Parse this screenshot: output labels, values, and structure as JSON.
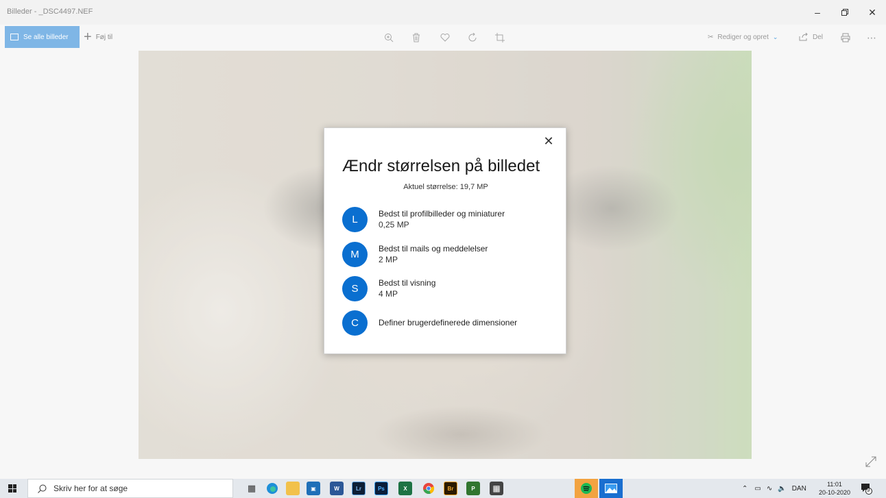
{
  "window": {
    "title": "Billeder - _DSC4497.NEF",
    "minimize_icon": "minimize-icon",
    "maximize_icon": "maximize-icon",
    "close_icon": "close-icon"
  },
  "toolbar": {
    "see_all_label": "Se alle billeder",
    "add_to_label": "Føj til",
    "edit_create_label": "Rediger og opret",
    "share_label": "Del",
    "tools": [
      "zoom-in-icon",
      "delete-icon",
      "favorite-heart-icon",
      "rotate-icon",
      "crop-icon"
    ],
    "accent": "#7fb6e6"
  },
  "dialog": {
    "title": "Ændr størrelsen på billedet",
    "current_size": "Aktuel størrelse: 19,7 MP",
    "options": [
      {
        "letter": "L",
        "label": "Bedst til profilbilleder og miniaturer",
        "size": "0,25 MP"
      },
      {
        "letter": "M",
        "label": "Bedst til mails og meddelelser",
        "size": "2 MP"
      },
      {
        "letter": "S",
        "label": "Bedst til visning",
        "size": "4 MP"
      },
      {
        "letter": "C",
        "label": "Definer brugerdefinerede dimensioner",
        "size": ""
      }
    ],
    "badge_color": "#0a6fd0"
  },
  "taskbar": {
    "search_placeholder": "Skriv her for at søge",
    "language": "DAN",
    "time": "11:01",
    "date": "20-10-2020",
    "notification_count": "9",
    "apps": [
      {
        "name": "task-view-icon",
        "label": ""
      },
      {
        "name": "edge-icon",
        "label": ""
      },
      {
        "name": "file-explorer-icon",
        "label": ""
      },
      {
        "name": "store-icon",
        "label": ""
      },
      {
        "name": "word-icon",
        "label": "W"
      },
      {
        "name": "lightroom-icon",
        "label": "Lr"
      },
      {
        "name": "photoshop-icon",
        "label": "Ps"
      },
      {
        "name": "excel-icon",
        "label": "X"
      },
      {
        "name": "chrome-icon",
        "label": ""
      },
      {
        "name": "bridge-icon",
        "label": "Br"
      },
      {
        "name": "project-icon",
        "label": "P"
      },
      {
        "name": "calculator-icon",
        "label": ""
      },
      {
        "name": "spotify-icon",
        "label": ""
      },
      {
        "name": "photos-icon",
        "label": ""
      }
    ]
  }
}
